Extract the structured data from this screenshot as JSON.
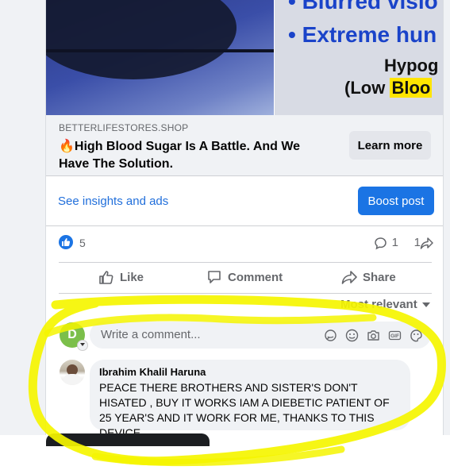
{
  "ad": {
    "line1": "• Blurred visio",
    "line2": "• Extreme hun",
    "line3": "Hypog",
    "line4_prefix": "(Low ",
    "line4_highlight": "Bloo",
    "highlight_color": "#ffe500"
  },
  "link": {
    "domain": "BETTERLIFESTORES.SHOP",
    "headline": "🔥High Blood Sugar Is A Battle. And We Have The Solution.",
    "cta": "Learn more"
  },
  "insights": {
    "link": "See insights and ads",
    "boost": "Boost post"
  },
  "stats": {
    "likes": "5",
    "comments": "1",
    "shares": "1"
  },
  "actions": {
    "like": "Like",
    "comment": "Comment",
    "share": "Share"
  },
  "sort": {
    "label": "Most relevant"
  },
  "composer": {
    "avatar_letter": "D",
    "placeholder": "Write a comment..."
  },
  "comment": {
    "author": "Ibrahim Khalil Haruna",
    "text": "PEACE THERE BROTHERS AND SISTER'S DON'T HISATED , BUY IT WORKS IAM A DIEBETIC PATIENT OF 25 YEAR'S AND IT WORK FOR ME, THANKS TO THIS DEVICE."
  },
  "colors": {
    "accent": "#1b74e4",
    "annotation": "#f5f500"
  }
}
